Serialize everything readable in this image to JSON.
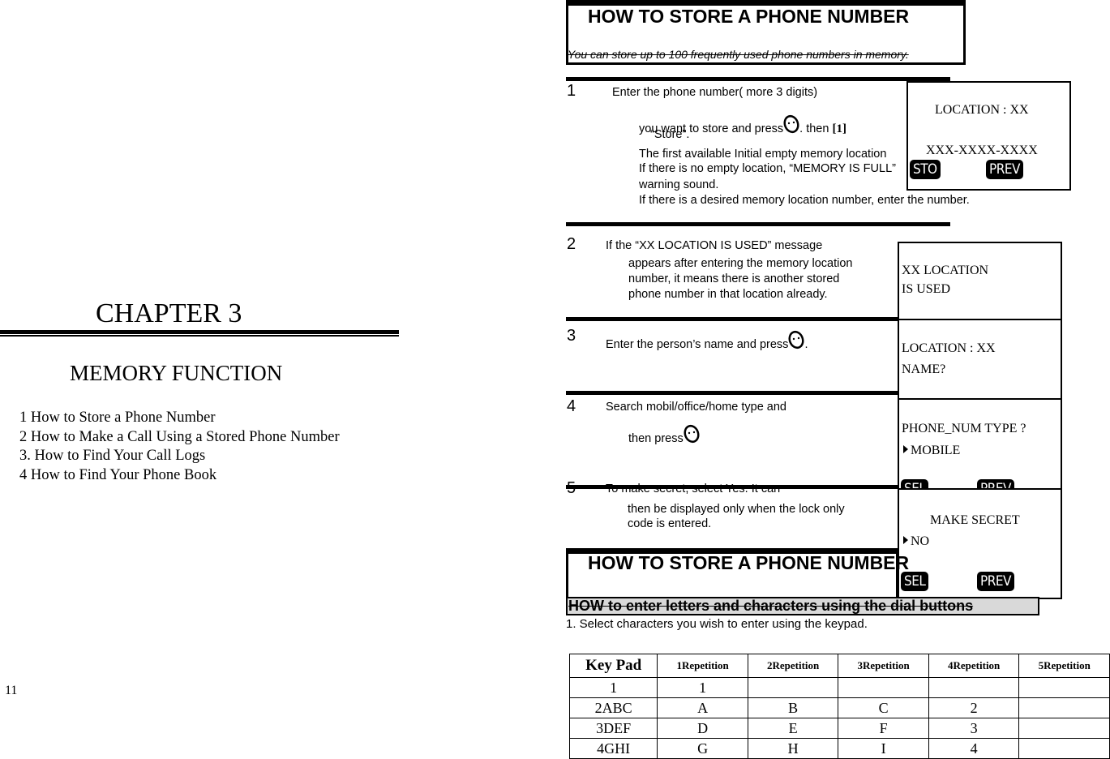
{
  "left_page": {
    "chapter_title": "CHAPTER 3",
    "section_title": "MEMORY FUNCTION",
    "toc": [
      "1 How to Store a Phone Number",
      "2 How to Make a Call Using a Stored Phone Number",
      "3. How to Find Your Call Logs",
      "4 How to Find Your Phone Book"
    ],
    "page_number": "11"
  },
  "right_page": {
    "heading": "HOW TO STORE A PHONE NUMBER",
    "intro": "You can store up to 100 frequently used phone numbers in memory.",
    "steps": [
      {
        "number": "1",
        "lines": [
          "Enter the phone number( more 3 digits)",
          "you want to store and press",
          ". then ",
          "[1]",
          "“Store”.",
          "The first available Initial empty memory location",
          "If there is no empty location, “MEMORY IS FULL”",
          "warning sound.",
          "If there is a desired memory location number, enter the number."
        ]
      },
      {
        "number": "2",
        "lines": [
          "If the “XX LOCATION IS USED” message",
          "appears after entering the memory location",
          "number, it means there is another stored",
          "phone number in that location already."
        ]
      },
      {
        "number": "3",
        "lines": [
          "Enter the person’s name and press",
          "."
        ]
      },
      {
        "number": "4",
        "lines": [
          "Search mobil/office/home type and",
          "then press"
        ]
      },
      {
        "number": "5",
        "lines": [
          "To make secret, select Yes. It can",
          "then be displayed only when the lock only",
          "code is entered."
        ]
      }
    ],
    "screens": [
      {
        "lines": [
          "LOCATION : XX",
          "XXX-XXXX-XXXX"
        ],
        "softkeys": [
          "STO",
          "PREV"
        ]
      },
      {
        "lines": [
          "XX LOCATION",
          "IS USED"
        ],
        "softkeys": []
      },
      {
        "lines": [
          "LOCATION : XX",
          "NAME?"
        ],
        "softkeys": []
      },
      {
        "lines": [
          "PHONE_NUM  TYPE ?",
          "MOBILE"
        ],
        "softkeys": [
          "SEL",
          "PREV"
        ]
      },
      {
        "lines": [
          "MAKE SECRET",
          "NO"
        ],
        "softkeys": [
          "SEL",
          "PREV"
        ]
      }
    ],
    "heading_repeat": "HOW TO STORE A PHONE NUMBER",
    "subheading": "HOW to enter letters and characters using the dial buttons",
    "keypad_instruction": "1. Select characters you wish to enter using the keypad.",
    "keypad_table": {
      "headers": [
        "Key Pad",
        "1Repetition",
        "2Repetition",
        "3Repetition",
        "4Repetition",
        "5Repetition"
      ],
      "rows": [
        [
          "1",
          "1",
          "",
          "",
          "",
          ""
        ],
        [
          "2ABC",
          "A",
          "B",
          "C",
          "2",
          ""
        ],
        [
          "3DEF",
          "D",
          "E",
          "F",
          "3",
          ""
        ],
        [
          "4GHI",
          "G",
          "H",
          "I",
          "4",
          ""
        ]
      ]
    }
  }
}
